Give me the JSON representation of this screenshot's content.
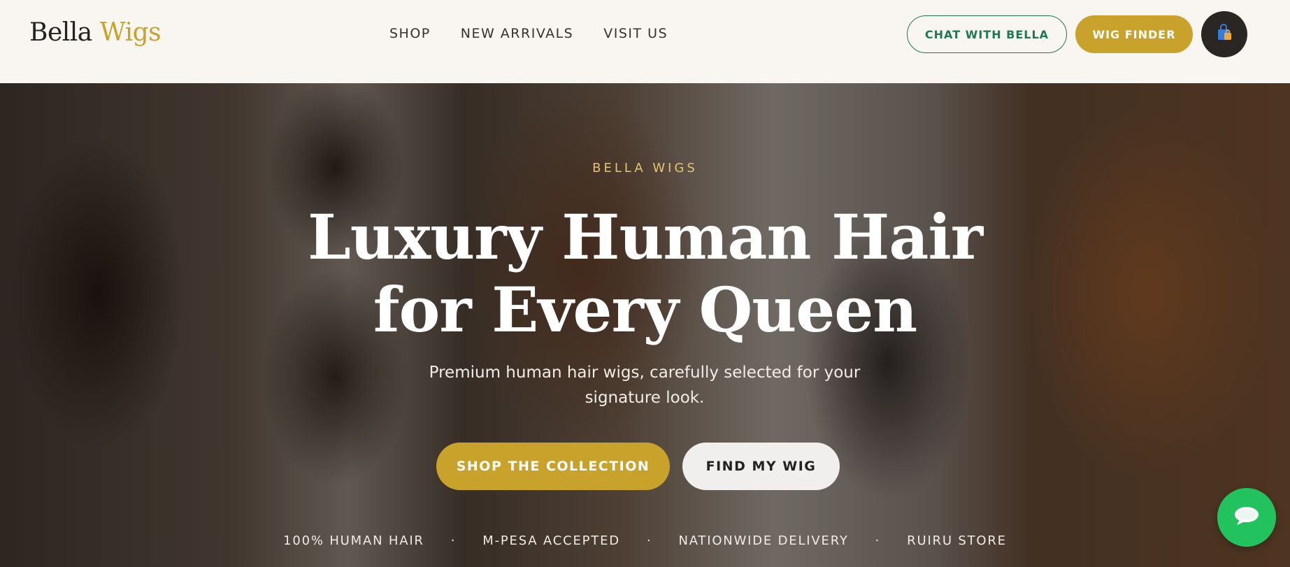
{
  "brand": {
    "name_part1": "Bella",
    "name_part2": "Wigs",
    "accent_color": "#c9a22c"
  },
  "nav": {
    "items": [
      {
        "label": "SHOP"
      },
      {
        "label": "NEW ARRIVALS"
      },
      {
        "label": "VISIT US"
      }
    ]
  },
  "header_actions": {
    "chat_label": "CHAT WITH BELLA",
    "finder_label": "WIG FINDER",
    "cart_icon": "shopping-bag-icon"
  },
  "hero": {
    "eyebrow": "BELLA WIGS",
    "headline_line1": "Luxury Human Hair",
    "headline_line2": "for Every Queen",
    "subhead_line1": "Premium human hair wigs, carefully selected for your",
    "subhead_line2": "signature look.",
    "primary_cta": "SHOP THE COLLECTION",
    "secondary_cta": "FIND MY WIG",
    "features": [
      "100% HUMAN HAIR",
      "M-PESA ACCEPTED",
      "NATIONWIDE DELIVERY",
      "RUIRU STORE"
    ],
    "separator": "·"
  },
  "floating_chat": {
    "icon": "chat-bubble-icon",
    "color": "#22c35e"
  },
  "colors": {
    "gold": "#c9a22c",
    "green": "#1e7a52",
    "background": "#f9f6f1"
  }
}
